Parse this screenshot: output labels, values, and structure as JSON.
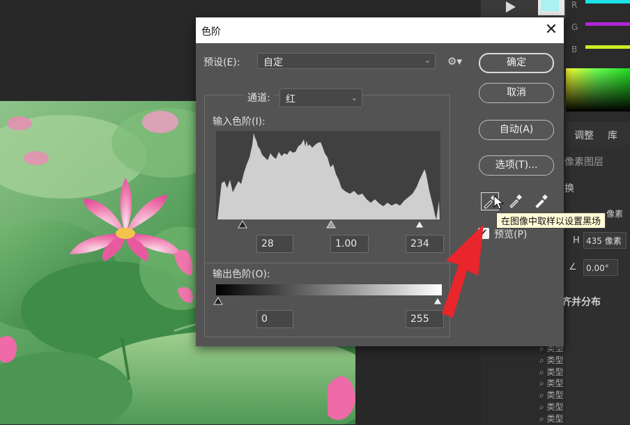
{
  "dialog": {
    "title": "色阶",
    "preset_label": "预设(E):",
    "preset_value": "自定",
    "channel_label": "通道:",
    "channel_value": "红",
    "input_levels_label": "输入色阶(I):",
    "input_black": "28",
    "input_gamma": "1.00",
    "input_white": "234",
    "output_levels_label": "输出色阶(O):",
    "output_black": "0",
    "output_white": "255",
    "buttons": {
      "ok": "确定",
      "cancel": "取消",
      "auto": "自动(A)",
      "options": "选项(T)..."
    },
    "preview_label": "预览(P)",
    "preview_checked": true,
    "tooltip": "在图像中取样以设置黑场"
  },
  "right_panel": {
    "color_channels": [
      "R",
      "G",
      "B"
    ],
    "tabs": [
      "调整",
      "库"
    ],
    "layer_type": "像素图层",
    "transform_partial": "换",
    "pixels_partial": "像素",
    "height_label": "H",
    "height_value": "435 像素",
    "angle_value": "0.00°",
    "align_label": "齐并分布",
    "layer_filter_label": "类型"
  },
  "colors": {
    "dialog_bg": "#535353",
    "accent_red": "#e8262b",
    "tooltip_bg": "#fffbd6"
  }
}
